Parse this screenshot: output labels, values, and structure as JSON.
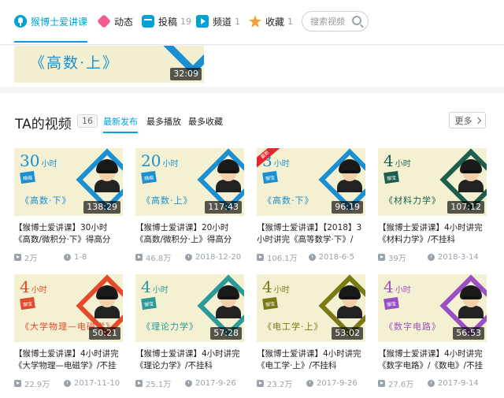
{
  "nav": {
    "home": "猴博士爱讲课",
    "dynamic": "动态",
    "posts": "投稿",
    "posts_count": "19",
    "channels": "频道",
    "channels_count": "1",
    "favorites": "收藏",
    "favorites_count": "1",
    "search_placeholder": "搜索视频"
  },
  "upper_card": {
    "thumb_title": "《高数·上》",
    "duration": "32:09"
  },
  "section": {
    "title": "TA的视频",
    "count": "16",
    "tabs": [
      "最新发布",
      "最多播放",
      "最多收藏"
    ],
    "more": "更多"
  },
  "accent_color": "#00a1d6",
  "videos": [
    {
      "thumb_hours": "30",
      "thumb_unit": "小时",
      "thumb_badge": "精缩",
      "thumb_subject": "《高数·下》",
      "theme_color": "#1a8fd1",
      "duration": "138:29",
      "title": "【猴博士爱讲课】30小时《高数/微积分·下》得高分",
      "plays": "2万",
      "date": "1-8"
    },
    {
      "thumb_hours": "20",
      "thumb_unit": "小时",
      "thumb_badge": "精缩",
      "thumb_subject": "《高数·上》",
      "theme_color": "#1a8fd1",
      "duration": "117:43",
      "title": "【猴博士爱讲课】20小时《高数/微积分·上》得高分",
      "plays": "46.8万",
      "date": "2018-12-20"
    },
    {
      "thumb_hours": "3",
      "thumb_unit": "小时",
      "thumb_badge": "御宝",
      "thumb_subject": "《高数·下》",
      "theme_color": "#1a8fd1",
      "duration": "96:19",
      "title": "【猴博士爱讲课】【2018】3小时讲完《高等数学·下》/",
      "plays": "106.1万",
      "date": "2018-6-5",
      "new_flag": "最新"
    },
    {
      "thumb_hours": "4",
      "thumb_unit": "小时",
      "thumb_badge": "御宝",
      "thumb_subject": "《材料力学》",
      "theme_color": "#1d5e4c",
      "duration": "107:12",
      "title": "【猴博士爱讲课】4小时讲完《材料力学》/不挂科",
      "plays": "39万",
      "date": "2018-3-14"
    },
    {
      "thumb_hours": "4",
      "thumb_unit": "小时",
      "thumb_badge": "御宝",
      "thumb_subject": "《大学物理—电磁学》",
      "theme_color": "#e4492b",
      "duration": "50:21",
      "title": "【猴博士爱讲课】4小时讲完《大学物理—电磁学》/不挂",
      "plays": "22.9万",
      "date": "2017-11-10"
    },
    {
      "thumb_hours": "4",
      "thumb_unit": "小时",
      "thumb_badge": "御宝",
      "thumb_subject": "《理论力学》",
      "theme_color": "#2b9a99",
      "duration": "57:28",
      "title": "【猴博士爱讲课】4小时讲完《理论力学》/不挂科",
      "plays": "25.1万",
      "date": "2017-9-26"
    },
    {
      "thumb_hours": "4",
      "thumb_unit": "小时",
      "thumb_badge": "御宝",
      "thumb_subject": "《电工学·上》",
      "theme_color": "#7a7a14",
      "duration": "53:02",
      "title": "【猴博士爱讲课】4小时讲完《电工学·上》/不挂科",
      "plays": "23.2万",
      "date": "2017-9-26"
    },
    {
      "thumb_hours": "4",
      "thumb_unit": "小时",
      "thumb_badge": "御宝",
      "thumb_subject": "《数字电路》",
      "theme_color": "#9b4fc4",
      "duration": "56:53",
      "title": "【猴博士爱讲课】4小时讲完《数字电路》/《数电》/不挂",
      "plays": "27.6万",
      "date": "2017-9-14"
    }
  ]
}
